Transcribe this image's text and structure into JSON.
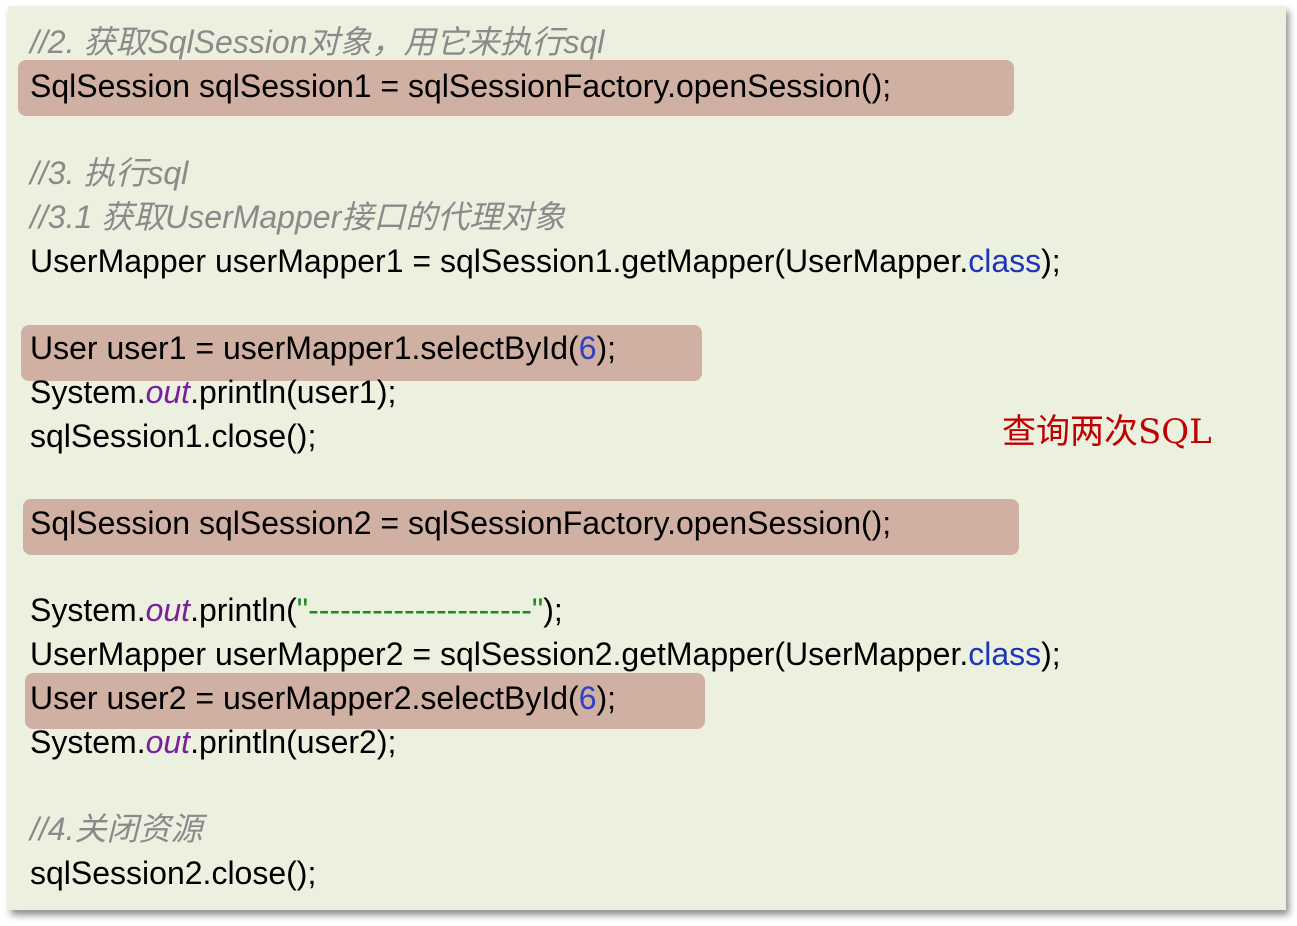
{
  "code": {
    "comment_get_session": "//2. 获取SqlSession对象，用它来执行sql",
    "open_session1": "SqlSession sqlSession1 = sqlSessionFactory.openSession();",
    "comment_execute": "//3. 执行sql",
    "comment_get_mapper": "//3.1 获取UserMapper接口的代理对象",
    "get_mapper1": {
      "pre": "UserMapper userMapper1 = sqlSession1.getMapper(UserMapper.",
      "kw": "class",
      "post": ");"
    },
    "select1": {
      "pre": "User user1 = userMapper1.selectById(",
      "num": "6",
      "post": ");"
    },
    "print1": {
      "pre": "System.",
      "field": "out",
      "post": ".println(user1);"
    },
    "close1": "sqlSession1.close();",
    "open_session2": "SqlSession sqlSession2 = sqlSessionFactory.openSession();",
    "print_sep": {
      "pre": "System.",
      "field": "out",
      "mid": ".println(",
      "str": "\"---------------------\"",
      "post": ");"
    },
    "get_mapper2": {
      "pre": "UserMapper userMapper2 = sqlSession2.getMapper(UserMapper.",
      "kw": "class",
      "post": ");"
    },
    "select2": {
      "pre": "User user2 = userMapper2.selectById(",
      "num": "6",
      "post": ");"
    },
    "print2": {
      "pre": "System.",
      "field": "out",
      "post": ".println(user2);"
    },
    "comment_close": "//4.关闭资源",
    "close2": "sqlSession2.close();"
  },
  "annotation": "查询两次SQL",
  "colors": {
    "panel_bg": "#ebf0df",
    "highlight": "#cfb0a2",
    "comment": "#8a8a8a",
    "keyword": "#1e35b8",
    "field": "#7a1f9a",
    "number": "#3040c0",
    "string": "#1f8a1f",
    "annotation": "#c00000"
  }
}
